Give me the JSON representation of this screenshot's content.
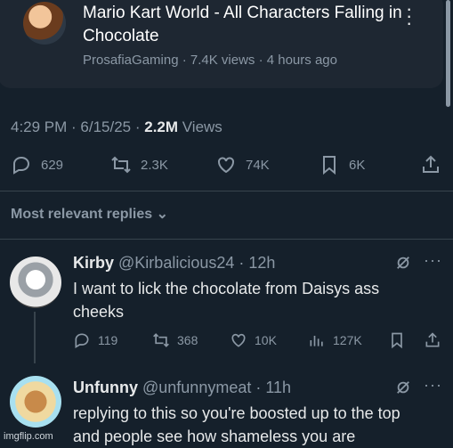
{
  "video_card": {
    "title": "Mario Kart World - All Characters Falling in Chocolate",
    "meta": "ProsafiaGaming · 7.4K views · 4 hours ago"
  },
  "post": {
    "time": "4:29 PM · 6/15/25 · ",
    "views_count": "2.2M",
    "views_label": " Views",
    "actions": {
      "replies": "629",
      "reposts": "2.3K",
      "likes": "74K",
      "bookmarks": "6K"
    }
  },
  "replies_filter": "Most relevant replies",
  "replies": [
    {
      "name": "Kirby",
      "handle": "@Kirbalicious24 · 12h",
      "text": "I want to lick the chocolate from Daisys ass cheeks",
      "stats": {
        "replies": "119",
        "reposts": "368",
        "likes": "10K",
        "views": "127K"
      }
    },
    {
      "name": "Unfunny",
      "handle": "@unfunnymeat · 11h",
      "text": "replying to this so you're boosted up to the top and people see how shameless you are"
    }
  ],
  "watermark": "imgflip.com",
  "colors": {
    "background": "#15202b",
    "muted": "#8b98a5",
    "text": "#e7e9ea"
  }
}
